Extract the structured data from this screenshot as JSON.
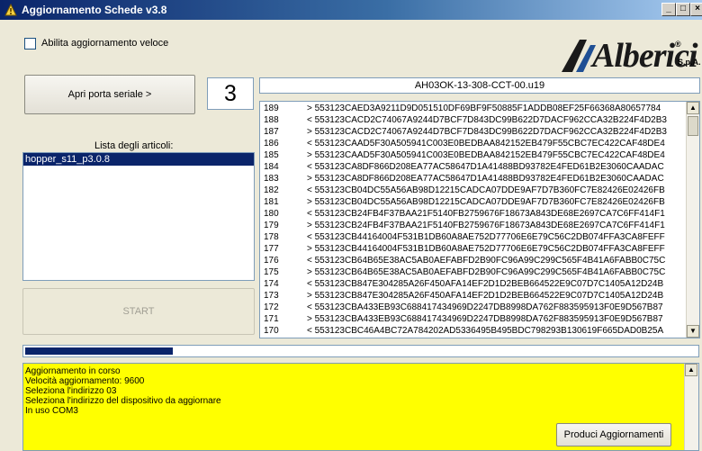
{
  "window": {
    "title": "Aggiornamento Schede  v3.8",
    "min_glyph": "_",
    "max_glyph": "□",
    "close_glyph": "×"
  },
  "colors": {
    "titlebar": "#0A246A",
    "status_background": "#FFFF00",
    "selection": "#0A246A",
    "logo_arrow": "#1f4f94"
  },
  "options": {
    "fast_update_label": "Abilita aggiornamento veloce",
    "fast_update_checked": false
  },
  "logo": {
    "text": "Alberici",
    "suffix": "S.p.A.",
    "registered": "®"
  },
  "controls": {
    "open_port_label": "Apri porta seriale     >",
    "counter": "3",
    "articles_label": "Lista degli articoli:",
    "articles": [
      "hopper_s11_p3.0.8"
    ],
    "start_label": "START",
    "produce_label": "Produci Aggiornamenti"
  },
  "file": {
    "name": "AH03OK-13-308-CCT-00.u19"
  },
  "log": {
    "rows": [
      {
        "num": "189",
        "data": "> 553123CAED3A9211D9D051510DF69BF9F50885F1ADDB08EF25F66368A80657784"
      },
      {
        "num": "188",
        "data": "< 553123CACD2C74067A9244D7BCF7D843DC99B622D7DACF962CCA32B224F4D2B3"
      },
      {
        "num": "187",
        "data": "> 553123CACD2C74067A9244D7BCF7D843DC99B622D7DACF962CCA32B224F4D2B3"
      },
      {
        "num": "186",
        "data": "< 553123CAAD5F30A505941C003E0BEDBAA842152EB479F55CBC7EC422CAF48DE4"
      },
      {
        "num": "185",
        "data": "> 553123CAAD5F30A505941C003E0BEDBAA842152EB479F55CBC7EC422CAF48DE4"
      },
      {
        "num": "184",
        "data": "< 553123CA8DF866D208EA77AC58647D1A41488BD93782E4FED61B2E3060CAADAC"
      },
      {
        "num": "183",
        "data": "> 553123CA8DF866D208EA77AC58647D1A41488BD93782E4FED61B2E3060CAADAC"
      },
      {
        "num": "182",
        "data": "< 553123CB04DC55A56AB98D12215CADCA07DDE9AF7D7B360FC7E82426E02426FB"
      },
      {
        "num": "181",
        "data": "> 553123CB04DC55A56AB98D12215CADCA07DDE9AF7D7B360FC7E82426E02426FB"
      },
      {
        "num": "180",
        "data": "< 553123CB24FB4F37BAA21F5140FB2759676F18673A843DE68E2697CA7C6FF414F1"
      },
      {
        "num": "179",
        "data": "> 553123CB24FB4F37BAA21F5140FB2759676F18673A843DE68E2697CA7C6FF414F1"
      },
      {
        "num": "178",
        "data": "< 553123CB44164004F531B1DB60A8AE752D77706E6E79C56C2DB074FFA3CA8FEFF"
      },
      {
        "num": "177",
        "data": "> 553123CB44164004F531B1DB60A8AE752D77706E6E79C56C2DB074FFA3CA8FEFF"
      },
      {
        "num": "176",
        "data": "< 553123CB64B65E38AC5AB0AEFABFD2B90FC96A99C299C565F4B41A6FABB0C75C"
      },
      {
        "num": "175",
        "data": "> 553123CB64B65E38AC5AB0AEFABFD2B90FC96A99C299C565F4B41A6FABB0C75C"
      },
      {
        "num": "174",
        "data": "< 553123CB847E304285A26F450AFA14EF2D1D2BEB664522E9C07D7C1405A12D24B"
      },
      {
        "num": "173",
        "data": "> 553123CB847E304285A26F450AFA14EF2D1D2BEB664522E9C07D7C1405A12D24B"
      },
      {
        "num": "172",
        "data": "< 553123CBA433EB93C688417434969D2247DB8998DA762F883595913F0E9D567B87"
      },
      {
        "num": "171",
        "data": "> 553123CBA433EB93C688417434969D2247DB8998DA762F883595913F0E9D567B87"
      },
      {
        "num": "170",
        "data": "< 553123CBC46A4BC72A784202AD5336495B495BDC798293B130619F665DAD0B25A"
      }
    ]
  },
  "progress": {
    "fraction": 0.22
  },
  "status": {
    "lines": [
      "Aggiornamento in corso",
      "Velocità aggiornamento: 9600",
      "Seleziona l'indirizzo 03",
      "Seleziona l'indirizzo del dispositivo da aggiornare",
      "In uso COM3"
    ]
  }
}
